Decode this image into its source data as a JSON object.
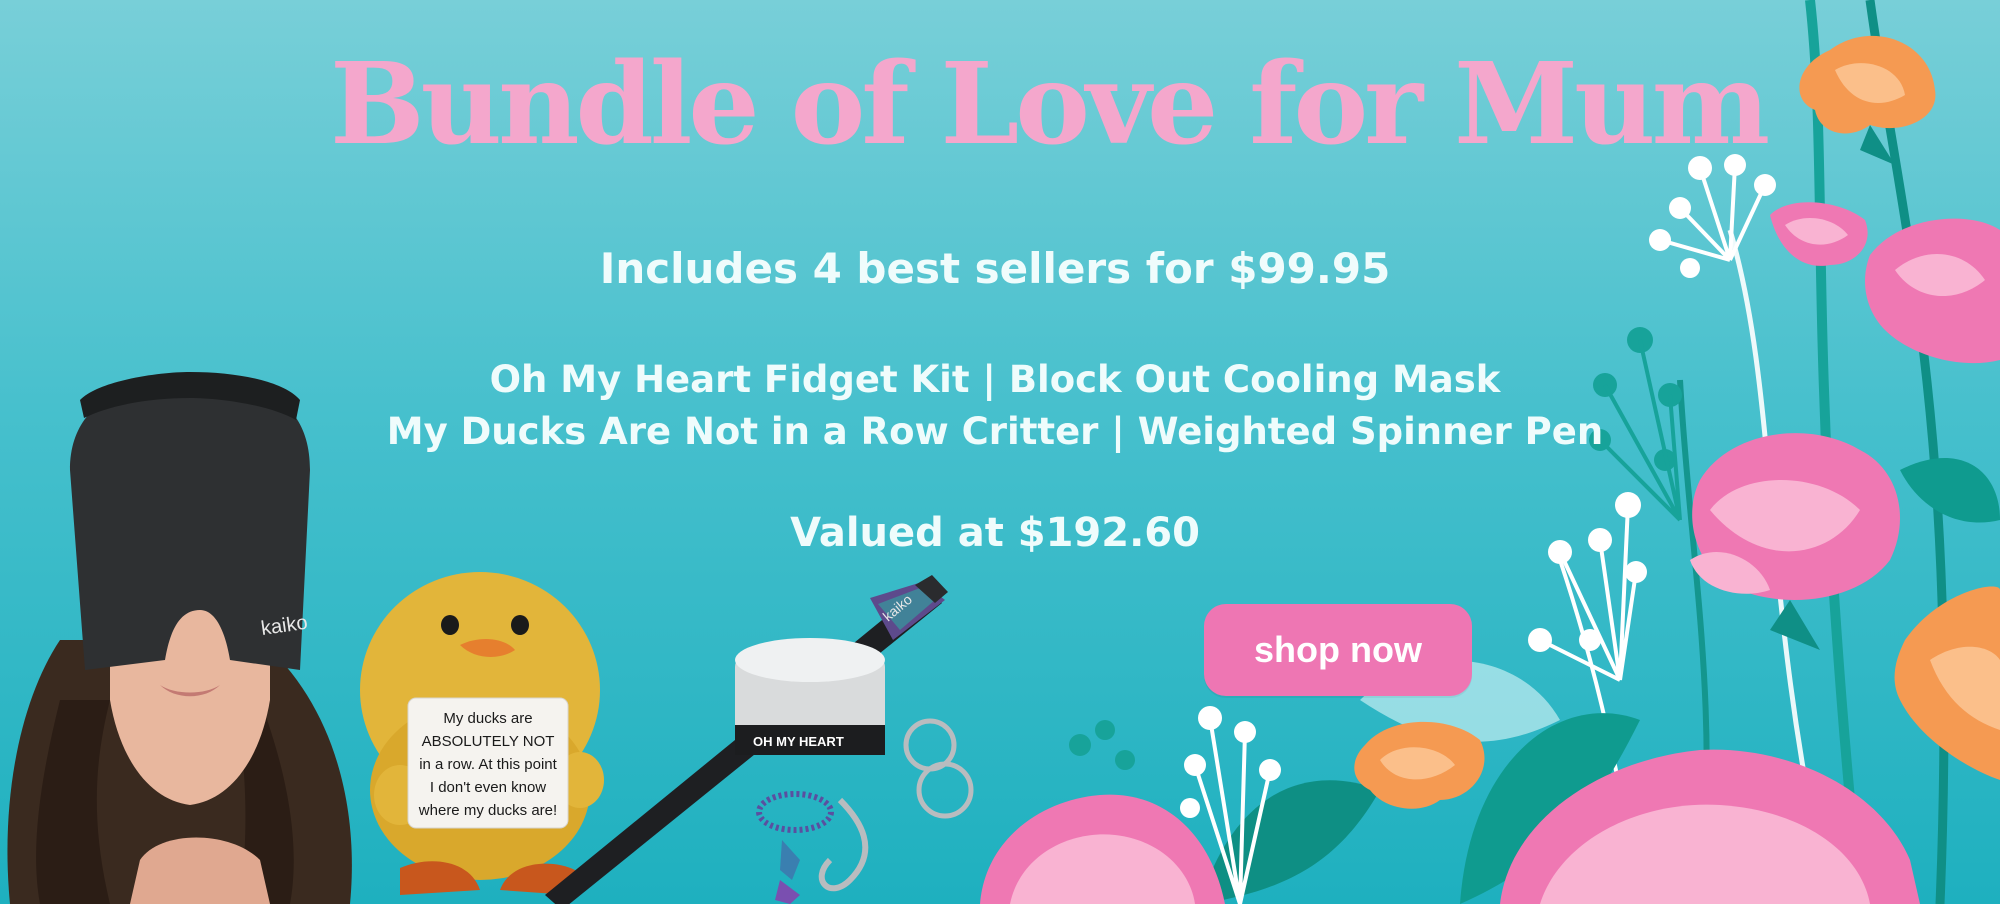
{
  "banner": {
    "headline": "Bundle of Love for Mum",
    "subheadline": "Includes 4 best sellers for $99.95",
    "items_line_1": "Oh My Heart Fidget Kit | Block Out Cooling Mask",
    "items_line_2": "My Ducks Are Not in a Row Critter | Weighted Spinner Pen",
    "valued_text": "Valued at $192.60",
    "cta_label": "shop now"
  },
  "products": {
    "mask_brand": "kaiko",
    "pen_brand": "kaiko",
    "tin_label": "OH MY HEART",
    "critter_card": [
      "My ducks are",
      "ABSOLUTELY NOT",
      "in a row. At this point",
      "I don't even know",
      "where my ducks are!"
    ]
  },
  "colors": {
    "background_top": "#78cfd8",
    "background_bottom": "#1eb0bf",
    "headline_pink": "#f4a7cc",
    "cta_pink": "#ee76b3",
    "text_light": "#effcfc"
  }
}
